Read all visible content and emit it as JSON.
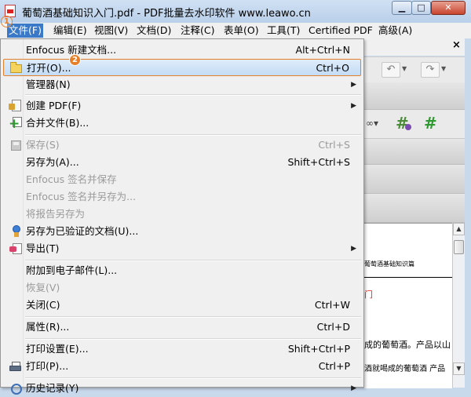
{
  "window": {
    "title": "葡萄酒基础知识入门.pdf - PDF批量去水印软件 www.leawo.cn",
    "minimize": "▁",
    "maximize": "□",
    "close": "✕"
  },
  "menubar": {
    "items": [
      "文件(F)",
      "编辑(E)",
      "视图(V)",
      "文档(D)",
      "注释(C)",
      "表单(O)",
      "工具(T)",
      "Certified PDF",
      "高级(A)"
    ]
  },
  "steps": {
    "one": "1",
    "two": "2"
  },
  "file_menu": {
    "items": [
      {
        "label": "Enfocus 新建文档...",
        "shortcut": "Alt+Ctrl+N",
        "submenu": false,
        "disabled": false
      },
      {
        "label": "打开(O)...",
        "shortcut": "Ctrl+O",
        "submenu": false,
        "disabled": false,
        "highlighted": true
      },
      {
        "label": "管理器(N)",
        "shortcut": "",
        "submenu": true,
        "disabled": false
      },
      {
        "label": "创建 PDF(F)",
        "shortcut": "",
        "submenu": true,
        "disabled": false
      },
      {
        "label": "合并文件(B)...",
        "shortcut": "",
        "submenu": false,
        "disabled": false
      },
      {
        "label": "保存(S)",
        "shortcut": "Ctrl+S",
        "submenu": false,
        "disabled": true
      },
      {
        "label": "另存为(A)...",
        "shortcut": "Shift+Ctrl+S",
        "submenu": false,
        "disabled": false
      },
      {
        "label": "Enfocus 签名并保存",
        "shortcut": "",
        "submenu": false,
        "disabled": true
      },
      {
        "label": "Enfocus 签名并另存为...",
        "shortcut": "",
        "submenu": false,
        "disabled": true
      },
      {
        "label": "将报告另存为",
        "shortcut": "",
        "submenu": false,
        "disabled": true
      },
      {
        "label": "另存为已验证的文档(U)...",
        "shortcut": "",
        "submenu": false,
        "disabled": false
      },
      {
        "label": "导出(T)",
        "shortcut": "",
        "submenu": true,
        "disabled": false
      },
      {
        "label": "附加到电子邮件(L)...",
        "shortcut": "",
        "submenu": false,
        "disabled": false
      },
      {
        "label": "恢复(V)",
        "shortcut": "",
        "submenu": false,
        "disabled": true
      },
      {
        "label": "关闭(C)",
        "shortcut": "Ctrl+W",
        "submenu": false,
        "disabled": false
      },
      {
        "label": "属性(R)...",
        "shortcut": "Ctrl+D",
        "submenu": false,
        "disabled": false
      },
      {
        "label": "打印设置(E)...",
        "shortcut": "Shift+Ctrl+P",
        "submenu": false,
        "disabled": false
      },
      {
        "label": "打印(P)...",
        "shortcut": "Ctrl+P",
        "submenu": false,
        "disabled": false
      },
      {
        "label": "历史记录(Y)",
        "shortcut": "",
        "submenu": true,
        "disabled": false
      }
    ],
    "submenu_arrow": "▶"
  },
  "document": {
    "close_label": "×",
    "heading": "葡萄酒基础知识篇",
    "red_text": "门",
    "line1": "成的葡萄酒。产品以山",
    "line2": "酒就喝成的葡萄酒 产品"
  },
  "scrollbar": {
    "up": "▲",
    "down": "▼"
  },
  "icons": {
    "app": "pdf-file-icon",
    "open": "folder-icon",
    "create_pdf": "create-pdf-icon",
    "combine": "combine-files-icon",
    "save": "save-icon",
    "certified": "certificate-ribbon-icon",
    "export": "export-icon",
    "print": "printer-icon",
    "history": "history-icon"
  }
}
